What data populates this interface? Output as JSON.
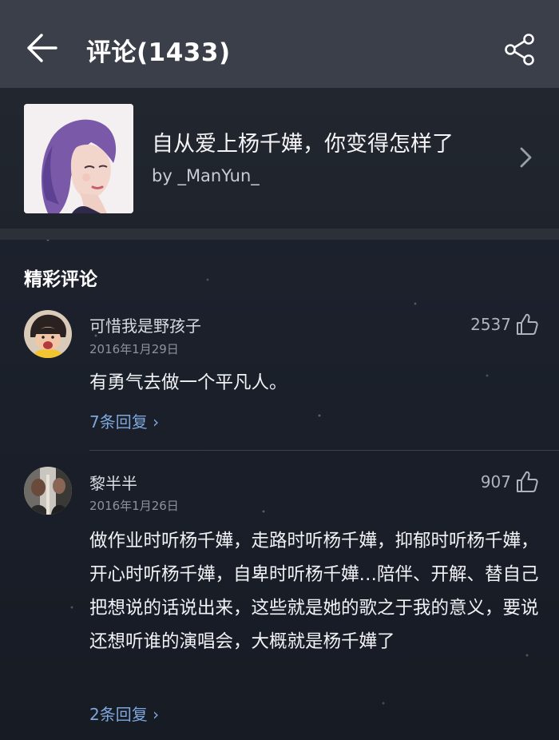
{
  "header": {
    "title": "评论(1433)",
    "back_icon": "arrow-left-icon",
    "share_icon": "share-icon"
  },
  "playlist": {
    "title": "自从爱上杨千嬅，你变得怎样了",
    "by_prefix": "by ",
    "author": "_ManYun_"
  },
  "section": {
    "title": "精彩评论"
  },
  "comments": [
    {
      "username": "可惜我是野孩子",
      "date": "2016年1月29日",
      "likes": "2537",
      "text": "有勇气去做一个平凡人。",
      "replies": "7条回复 ›"
    },
    {
      "username": "黎半半",
      "date": "2016年1月26日",
      "likes": "907",
      "text": "做作业时听杨千嬅，走路时听杨千嬅，抑郁时听杨千嬅，开心时听杨千嬅，自卑时听杨千嬅…陪伴、开解、替自己把想说的话说出来，这些就是她的歌之于我的意义，要说还想听谁的演唱会，大概就是杨千嬅了",
      "replies": "2条回复 ›"
    }
  ],
  "colors": {
    "topbar": "#3a3f49",
    "background": "#1b202b",
    "reply_link": "#7ea7dc"
  }
}
